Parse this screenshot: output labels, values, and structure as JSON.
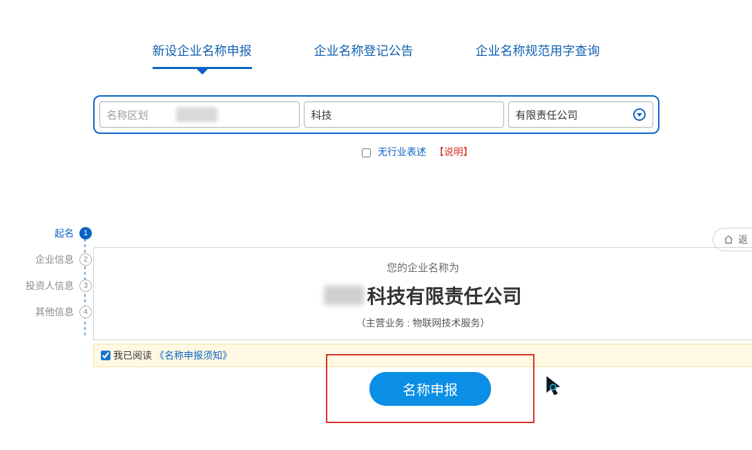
{
  "tabs": [
    {
      "label": "新设企业名称申报"
    },
    {
      "label": "企业名称登记公告"
    },
    {
      "label": "企业名称规范用字查询"
    }
  ],
  "form": {
    "region_placeholder": "名称区划",
    "region_value_redacted": true,
    "industry_value": "科技",
    "orgtype_value": "有限责任公司"
  },
  "no_industry": {
    "label": "无行业表述",
    "explain": "【说明】"
  },
  "steps": [
    {
      "label": "起名",
      "num": "1"
    },
    {
      "label": "企业信息",
      "num": "2"
    },
    {
      "label": "投资人信息",
      "num": "3"
    },
    {
      "label": "其他信息",
      "num": "4"
    }
  ],
  "preview": {
    "lead": "您的企业名称为",
    "name_prefix_redacted": true,
    "name_suffix": "科技有限责任公司",
    "business": "（主营业务 : 物联网技术服务）"
  },
  "agreement": {
    "prefix": "我已阅读",
    "link": "《名称申报须知》",
    "checked": true
  },
  "submit_label": "名称申报",
  "return_label": "返"
}
